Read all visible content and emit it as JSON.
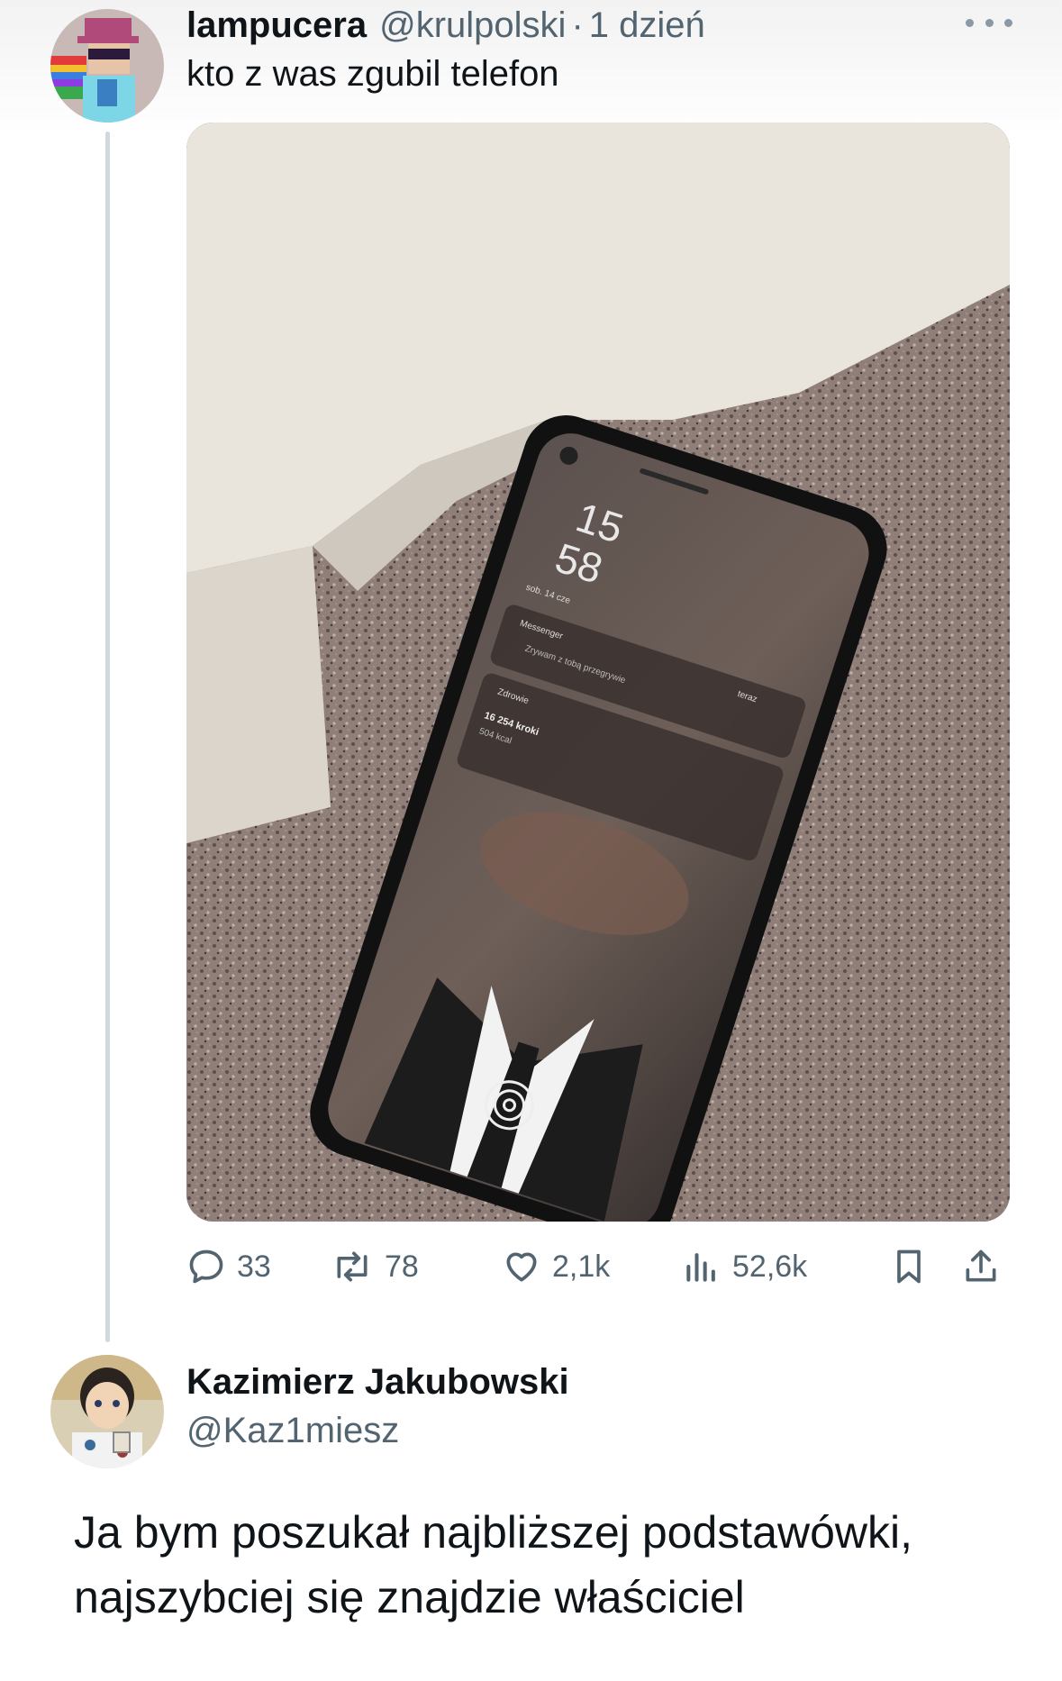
{
  "tweet": {
    "display_name": "lampucera",
    "handle": "@krulpolski",
    "separator": "·",
    "time": "1 dzień",
    "text": "kto z was zgubil telefon",
    "avatar_icon": "avatar-pixel-character",
    "more_icon": "ellipsis-icon",
    "media": {
      "phone_time_hours": "15",
      "phone_time_minutes": "58",
      "phone_date": "sob. 14 cze",
      "notification_app": "Messenger",
      "notification_text": "Zrywam z tobą przegrywie",
      "notification_time": "teraz",
      "health_app": "Zdrowie",
      "health_steps": "16 254 kroki",
      "health_kcal": "504 kcal"
    },
    "actions": {
      "replies": "33",
      "reposts": "78",
      "likes": "2,1k",
      "views": "52,6k"
    }
  },
  "reply": {
    "display_name": "Kazimierz Jakubowski",
    "handle": "@Kaz1miesz",
    "avatar_icon": "avatar-anime-boy",
    "text": "Ja bym poszukał najbliższej podstawówki, najszybciej się znajdzie właściciel"
  },
  "colors": {
    "text_primary": "#0f1419",
    "text_secondary": "#536471",
    "thread_line": "#cfd9de"
  }
}
